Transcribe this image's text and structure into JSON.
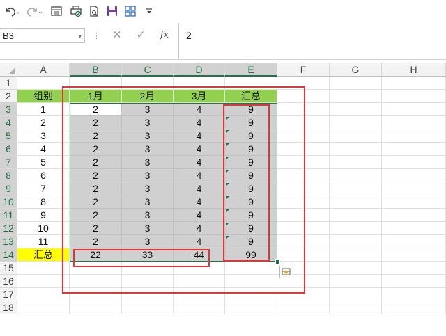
{
  "toolbar": {
    "icons": [
      "undo-icon",
      "redo-icon",
      "format-table-icon",
      "print-preview-icon",
      "print-icon",
      "save-icon",
      "layout-icon",
      "more-icon"
    ]
  },
  "formula_bar": {
    "name_box": "B3",
    "cancel_glyph": "✕",
    "enter_glyph": "✓",
    "fx_glyph": "fx",
    "value": "2"
  },
  "columns": [
    "A",
    "B",
    "C",
    "D",
    "E",
    "F",
    "G",
    "H"
  ],
  "rows": [
    "1",
    "2",
    "3",
    "4",
    "5",
    "6",
    "7",
    "8",
    "9",
    "10",
    "11",
    "12",
    "13",
    "14",
    "15",
    "16",
    "17",
    "18"
  ],
  "table": {
    "header": [
      "组别",
      "1月",
      "2月",
      "3月",
      "汇总"
    ],
    "body": [
      [
        "1",
        "2",
        "3",
        "4",
        "9"
      ],
      [
        "2",
        "2",
        "3",
        "4",
        "9"
      ],
      [
        "3",
        "2",
        "3",
        "4",
        "9"
      ],
      [
        "4",
        "2",
        "3",
        "4",
        "9"
      ],
      [
        "5",
        "2",
        "3",
        "4",
        "9"
      ],
      [
        "6",
        "2",
        "3",
        "4",
        "9"
      ],
      [
        "7",
        "2",
        "3",
        "4",
        "9"
      ],
      [
        "8",
        "2",
        "3",
        "4",
        "9"
      ],
      [
        "9",
        "2",
        "3",
        "4",
        "9"
      ],
      [
        "10",
        "2",
        "3",
        "4",
        "9"
      ],
      [
        "11",
        "2",
        "3",
        "4",
        "9"
      ]
    ],
    "total": [
      "汇总",
      "22",
      "33",
      "44",
      "99"
    ]
  },
  "colors": {
    "header_fill": "#92d050",
    "total_fill": "#ffff00",
    "annotation_red": "#e5333a",
    "selection_green": "#217346"
  }
}
